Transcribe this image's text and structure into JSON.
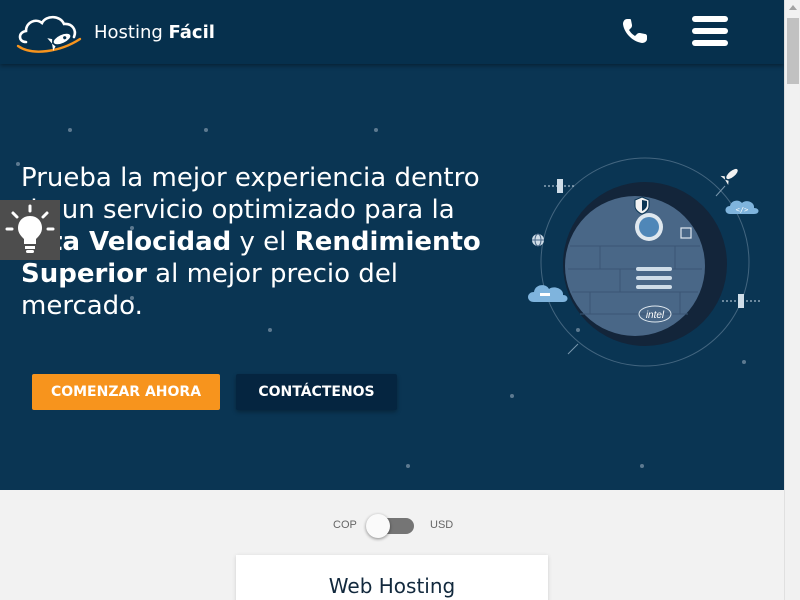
{
  "navbar": {
    "brand_light": "Hosting ",
    "brand_bold": "Fácil",
    "logo_icon": "cloud-rocket-logo",
    "phone_icon": "phone-icon",
    "menu_icon": "hamburger-menu-icon",
    "background": "#06304d"
  },
  "hero": {
    "headline_1": "Prueba la mejor experiencia dentro de un servicio optimizado para la ",
    "headline_bold_1": "Alta Velocidad",
    "headline_2": " y el ",
    "headline_bold_2": "Rendimiento Superior",
    "headline_3": " al mejor precio del mercado.",
    "primary_button": "COMENZAR AHORA",
    "secondary_button": "CONTÁCTENOS",
    "illustration_icons": [
      "shield-icon",
      "rocket-icon",
      "cloud-code-icon",
      "cloud-server-icon",
      "globe-icon",
      "satellite-icon",
      "intel-chip-icon",
      "server-icon"
    ],
    "background": "#0a3553",
    "accent": "#f7941d"
  },
  "accessibility": {
    "icon": "lightbulb-icon"
  },
  "pricing": {
    "currency_left": "COP",
    "currency_right": "USD",
    "card_title": "Web Hosting"
  }
}
